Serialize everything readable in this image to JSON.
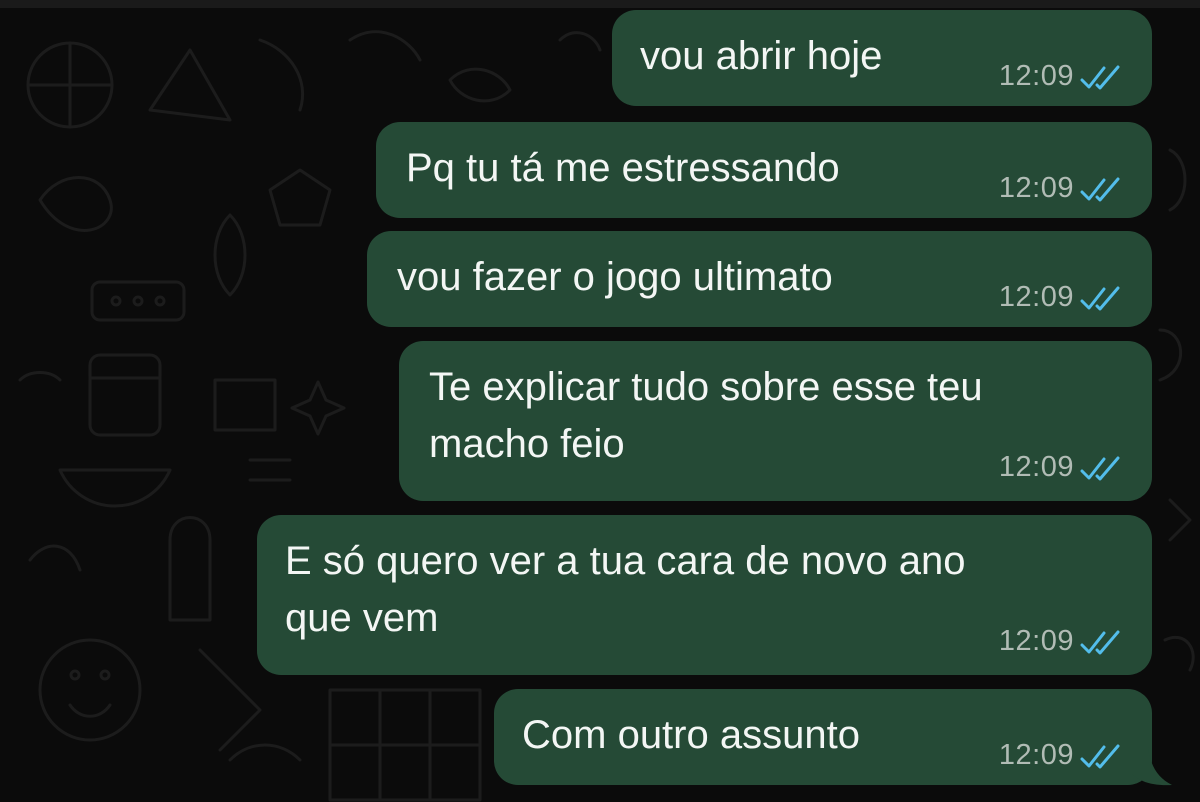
{
  "chat": {
    "messages": [
      {
        "text": "vou abrir hoje",
        "time": "12:09",
        "status": "read-double-check-icon"
      },
      {
        "text": "Pq tu tá me estressando",
        "time": "12:09",
        "status": "read-double-check-icon"
      },
      {
        "text": "vou fazer o jogo ultimato",
        "time": "12:09",
        "status": "read-double-check-icon"
      },
      {
        "text": "Te explicar tudo sobre esse teu\nmacho feio",
        "time": "12:09",
        "status": "read-double-check-icon"
      },
      {
        "text": "E só quero ver a tua cara de novo ano\nque vem",
        "time": "12:09",
        "status": "read-double-check-icon"
      },
      {
        "text": "Com outro assunto",
        "time": "12:09",
        "status": "read-double-check-icon"
      }
    ]
  },
  "colors": {
    "bubble_outgoing": "#254a36",
    "background": "#0b0b0b",
    "read_ticks": "#53bdeb",
    "time_text": "#b1bcb5"
  }
}
